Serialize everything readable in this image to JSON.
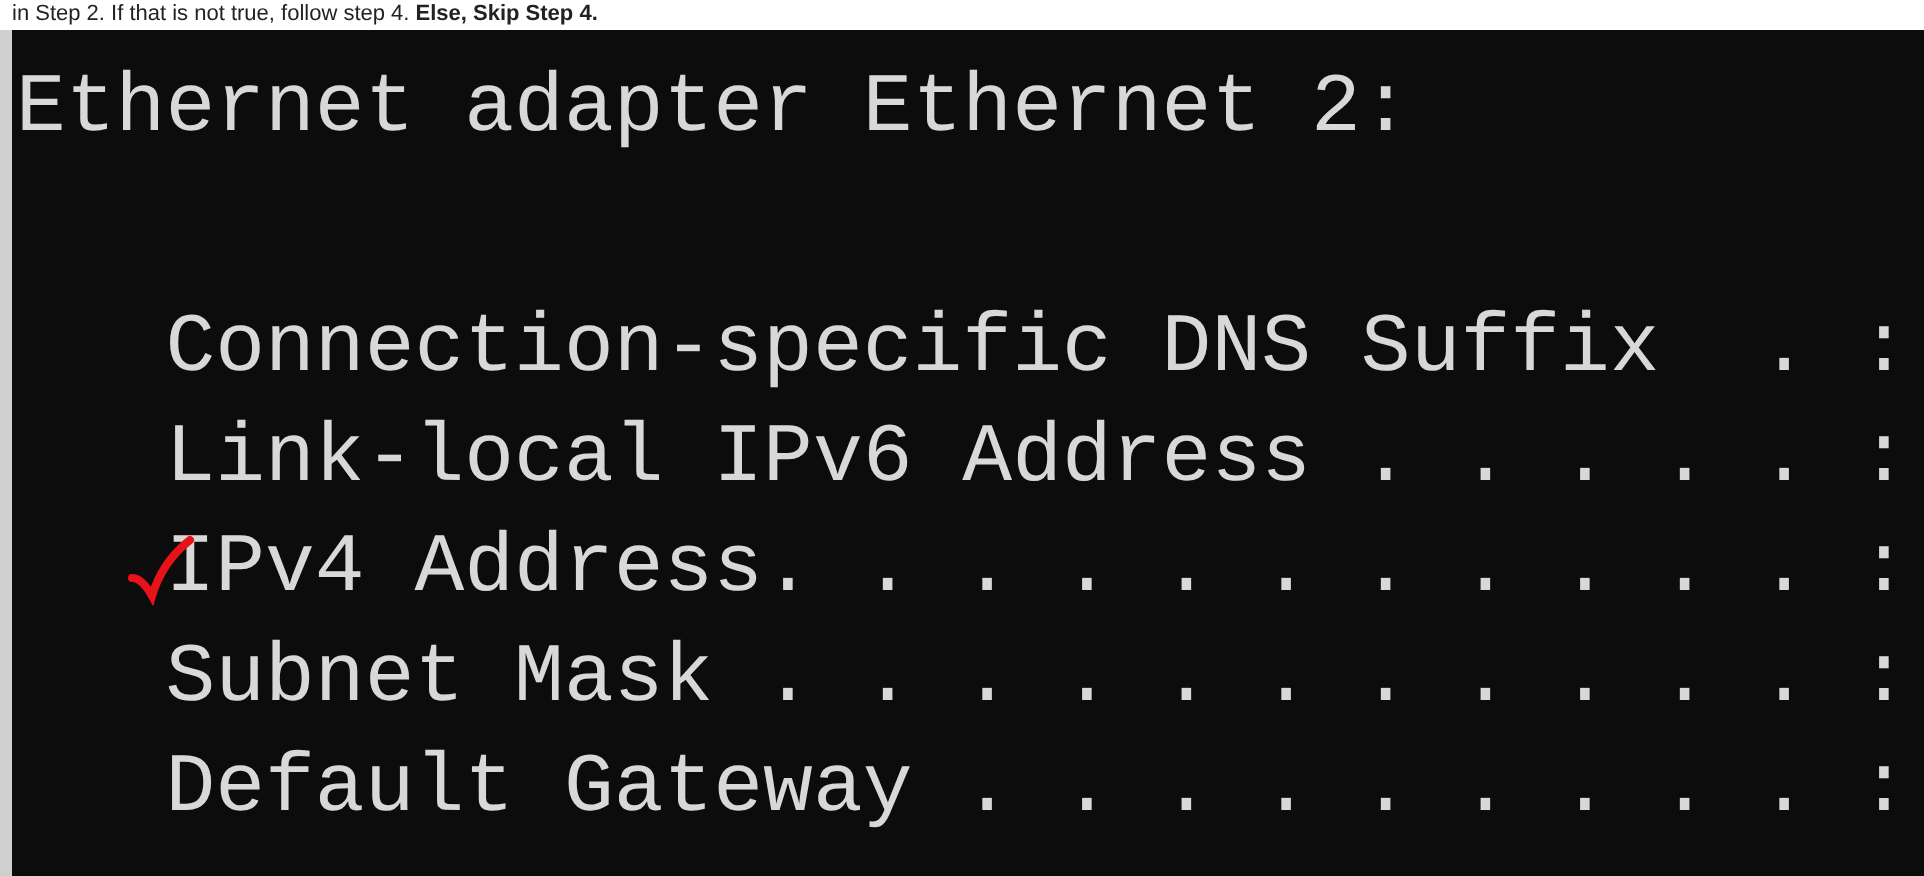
{
  "instruction": "in Step 2. If that is not true, follow step 4. **Else, Skip Step 4.**",
  "console": {
    "heading": "Ethernet adapter Ethernet 2:",
    "rows": [
      {
        "text": "   Connection-specific DNS Suffix  . :",
        "ticked": false
      },
      {
        "text": "   Link-local IPv6 Address . . . . . :",
        "ticked": false
      },
      {
        "text": "   IPv4 Address. . . . . . . . . . . :",
        "ticked": true
      },
      {
        "text": "   Subnet Mask . . . . . . . . . . . :",
        "ticked": false
      },
      {
        "text": "   Default Gateway . . . . . . . . . :",
        "ticked": false
      }
    ]
  }
}
